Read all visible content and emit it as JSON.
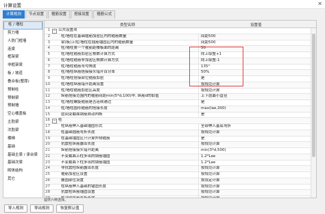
{
  "window": {
    "title": "计算设置",
    "close_glyph": "✕"
  },
  "tabs": [
    "计算规则",
    "节点设置",
    "箍筋设置",
    "搭接设置",
    "箍筋公式"
  ],
  "active_tab": 0,
  "sidebar": {
    "items": [
      "柱 / 墙柱",
      "剪力墙",
      "人防门框墙",
      "连梁",
      "框架梁",
      "非框架梁",
      "板 / 坡道",
      "叠合板(整厚)",
      "预制柱",
      "预制梁",
      "预制墙",
      "空心楼盖板",
      "主肋梁",
      "次肋梁",
      "楼梯",
      "基础",
      "基础主梁 / 承台梁",
      "基础次梁",
      "砌体结构",
      "其它"
    ],
    "active_index": 0
  },
  "table": {
    "headers": {
      "name": "类型名称",
      "value": "设置值"
    },
    "rows": [
      {
        "num": "1",
        "group": true,
        "expand": "−",
        "name": "公共设置项",
        "value": ""
      },
      {
        "num": "2",
        "name": "柱/墙柱在基础插筋加密区内的箍筋数量",
        "value": "间距500"
      },
      {
        "num": "3",
        "name": "梁(板)上柱/墙柱在插筋锚固区内的箍筋数量",
        "value": "间距500"
      },
      {
        "num": "4",
        "name": "柱/墙柱第一个箍筋距楼板面的距离",
        "value": "50"
      },
      {
        "num": "5",
        "name": "柱/墙柱箍筋加密区根数计算方式",
        "value": "向上取整+1"
      },
      {
        "num": "6",
        "name": "柱/墙柱箍筋非加密区根数计算方式",
        "value": "向上取整-1"
      },
      {
        "num": "7",
        "name": "柱/墙柱箍筋弯勾角度",
        "value": "135°"
      },
      {
        "num": "8",
        "name": "柱/墙柱纵筋搭接接头错开百分率",
        "value": "50%"
      },
      {
        "num": "9",
        "name": "柱/墙柱搭接部位箍筋加密",
        "value": "是"
      },
      {
        "num": "10",
        "name": "柱/墙柱纵筋错开距离设置",
        "value": "按规范计算"
      },
      {
        "num": "11",
        "name": "柱/墙柱箍筋加密区高度",
        "value": "按规范计算"
      },
      {
        "num": "12",
        "name": "纵筋搭接范围内的箍筋间距min(5*d,100)中, 纵筋d的取值",
        "value": "上下层最小直径"
      },
      {
        "num": "13",
        "name": "柱/墙柱螺旋箍筋是否连续通过",
        "value": "是"
      },
      {
        "num": "14",
        "name": "柱/墙柱圆形箍筋的搭接长度",
        "value": "max(lae,300)"
      },
      {
        "num": "15",
        "name": "层间变截面钢筋自动判断",
        "value": "是"
      },
      {
        "num": "16",
        "group": true,
        "expand": "−",
        "name": "柱",
        "value": ""
      },
      {
        "num": "17",
        "name": "柱纵筋伸入基础锚固形式",
        "value": "全部伸入基底弯折"
      },
      {
        "num": "18",
        "name": "柱基础插筋弯折长度",
        "value": "按规范计算"
      },
      {
        "num": "19",
        "name": "柱基础锚固区只计算外侧箍筋",
        "value": "是"
      },
      {
        "num": "20",
        "name": "抗震柱纵筋露出长度",
        "value": "按规范计算"
      },
      {
        "num": "21",
        "name": "纵筋搭接接头错开距离",
        "value": "min(3*d,500)"
      },
      {
        "num": "22",
        "name": "不变截面上柱多出的钢筋锚固",
        "value": "1.2*Lae"
      },
      {
        "num": "23",
        "name": "不变截面下柱多出的钢筋锚固",
        "value": "1.2*Lae"
      },
      {
        "num": "24",
        "name": "非抗震柱纵筋露出长度",
        "value": "按规范计算"
      },
      {
        "num": "25",
        "name": "箍筋加密区设置",
        "value": "按规范计算"
      },
      {
        "num": "26",
        "name": "嵌固部位设置",
        "value": "按设定计算"
      },
      {
        "num": "27",
        "name": "柱纵筋伸入基础的锚固长度",
        "value": "按规范计算"
      },
      {
        "num": "28",
        "name": "抗震柱纵筋锚固设置",
        "value": "按规范计算"
      },
      {
        "num": "29",
        "name": "柱顶部纵筋弯折长度",
        "value": "按规范计算"
      },
      {
        "num": "30",
        "name": "顶层柱纵筋锚固长度",
        "value": "按规范计算"
      }
    ]
  },
  "status_text": "提供六种选择。",
  "buttons": {
    "import": "导入规则",
    "export": "导出规则",
    "restore": "恢复默认值"
  }
}
